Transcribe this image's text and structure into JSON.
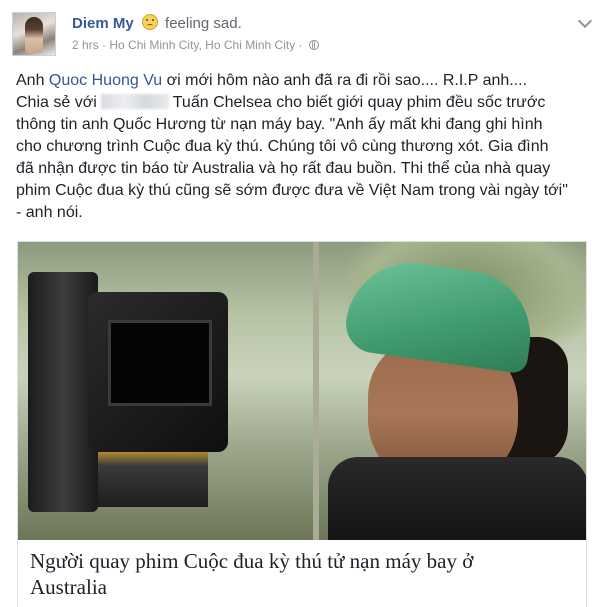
{
  "post": {
    "author": "Diem My",
    "feeling_icon": "sad-face-icon",
    "feeling_text": "feeling sad.",
    "time": "2 hrs",
    "separator": "·",
    "location": "Ho Chi Minh City, Ho Chi Minh City",
    "privacy_icon": "globe-icon",
    "body": {
      "l1_pre": "Anh ",
      "l1_mention": "Quoc Huong Vu",
      "l1_post": " ơi mới hôm nào anh đã ra đi rồi sao.... R.I.P anh....",
      "l2_pre": "Chia sẻ với",
      "l2_post": "Tuấn Chelsea cho biết giới quay phim đều sốc trước",
      "l3": "thông tin anh Quốc Hương từ nạn máy bay. \"Anh ấy mất khi đang ghi hình",
      "l4": "cho chương trình Cuộc đua kỳ thú. Chúng tôi vô cùng thương xót. Gia đình",
      "l5": "đã nhận được tin báo từ Australia và họ rất đau buồn. Thi thể của nhà quay",
      "l6": "phim Cuộc đua kỳ thú cũng sẽ sớm được đưa về Việt Nam trong vài ngày tới\"",
      "l7": "- anh nói."
    },
    "link": {
      "title_l1": "Người quay phim Cuộc đua kỳ thú tử nạn máy bay ở",
      "title_l2": "Australia"
    }
  },
  "colors": {
    "link_blue": "#365899",
    "meta_gray": "#90949c",
    "text": "#1d2129"
  }
}
